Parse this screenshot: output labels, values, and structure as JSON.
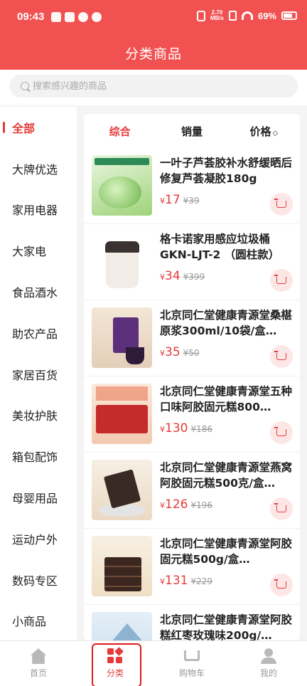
{
  "status_bar": {
    "time": "09:43",
    "net_speed_value": "2.70",
    "net_speed_unit": "MB/s",
    "battery": "69%"
  },
  "header": {
    "title": "分类商品"
  },
  "search": {
    "placeholder": "搜索感兴趣的商品"
  },
  "sidebar": {
    "items": [
      {
        "label": "全部"
      },
      {
        "label": "大牌优选"
      },
      {
        "label": "家用电器"
      },
      {
        "label": "大家电"
      },
      {
        "label": "食品酒水"
      },
      {
        "label": "助农产品"
      },
      {
        "label": "家居百货"
      },
      {
        "label": "美妆护肤"
      },
      {
        "label": "箱包配饰"
      },
      {
        "label": "母婴用品"
      },
      {
        "label": "运动户外"
      },
      {
        "label": "数码专区"
      },
      {
        "label": "小商品"
      }
    ],
    "active_index": 0
  },
  "sort_bar": {
    "tabs": [
      {
        "label": "综合"
      },
      {
        "label": "销量"
      },
      {
        "label": "价格"
      }
    ],
    "price_sort_icon": "◇"
  },
  "currency": "¥",
  "products": [
    {
      "name": "一叶子芦荟胶补水舒缓晒后修复芦荟凝胶180g",
      "price": "17",
      "original": "¥39",
      "image": "aloe-gel-image"
    },
    {
      "name": "格卡诺家用感应垃圾桶GKN-LJT-2 （圆柱款）(…",
      "price": "34",
      "original": "¥399",
      "image": "trash-bin-image"
    },
    {
      "name": "北京同仁堂健康青源堂桑椹原浆300ml/10袋/盒…",
      "price": "35",
      "original": "¥50",
      "image": "mulberry-juice-image"
    },
    {
      "name": "北京同仁堂健康青源堂五种口味阿胶固元糕800…",
      "price": "130",
      "original": "¥186",
      "image": "gift-box-image"
    },
    {
      "name": "北京同仁堂健康青源堂燕窝阿胶固元糕500克/盒…",
      "price": "126",
      "original": "¥196",
      "image": "cake-plate-image"
    },
    {
      "name": "北京同仁堂健康青源堂阿胶固元糕500g/盒…",
      "price": "131",
      "original": "¥229",
      "image": "cake-stack-image"
    },
    {
      "name": "北京同仁堂健康青源堂阿胶糕红枣玫瑰味200g/…",
      "price": "",
      "original": "",
      "image": "mountain-image"
    }
  ],
  "bottom_nav": {
    "items": [
      {
        "label": "首页"
      },
      {
        "label": "分类"
      },
      {
        "label": "购物车"
      },
      {
        "label": "我的"
      }
    ],
    "active_index": 1
  },
  "colors": {
    "brand_red": "#f25151",
    "accent_red": "#e63a3a",
    "highlight_border": "#d71d1d"
  }
}
